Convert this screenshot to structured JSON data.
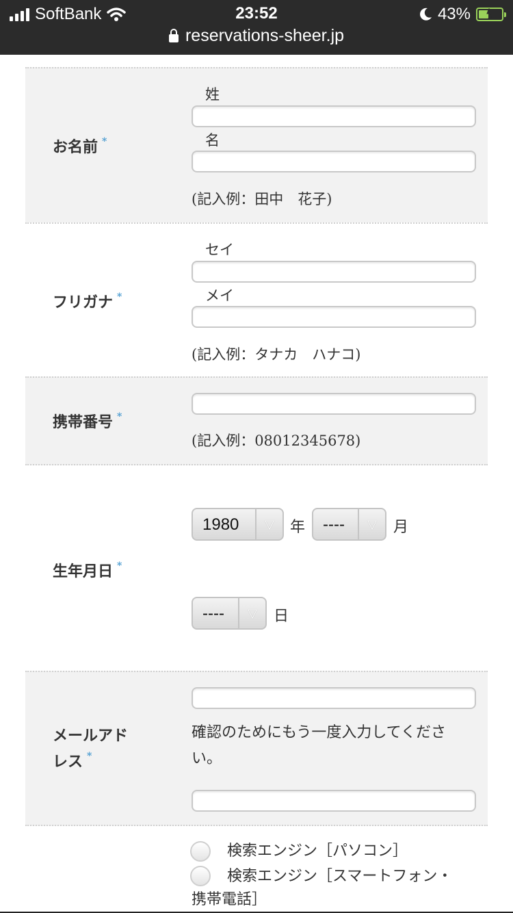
{
  "status_bar": {
    "carrier": "SoftBank",
    "time": "23:52",
    "battery": "43%",
    "battery_level": 0.43,
    "url": "reservations-sheer.jp"
  },
  "required_mark": "*",
  "name_row": {
    "label": "お名前",
    "last_label": "姓",
    "first_label": "名",
    "hint": "(記入例：田中　花子)"
  },
  "kana_row": {
    "label": "フリガナ",
    "last_label": "セイ",
    "first_label": "メイ",
    "hint": "(記入例：タナカ　ハナコ)"
  },
  "phone_row": {
    "label": "携帯番号",
    "hint": "(記入例：08012345678)"
  },
  "birth_row": {
    "label": "生年月日",
    "year_value": "1980",
    "year_unit": "年",
    "month_value": "----",
    "month_unit": "月",
    "day_value": "----",
    "day_unit": "日"
  },
  "email_row": {
    "label_line1": "メールアド",
    "label_line2": "レス",
    "confirm_note_line1": "確認のためにもう一度入力してくださ",
    "confirm_note_line2": "い。"
  },
  "source_row": {
    "options": [
      "検索エンジン［パソコン］",
      "検索エンジン［スマートフォン・"
    ],
    "option2_cont": "携帯電話］"
  }
}
